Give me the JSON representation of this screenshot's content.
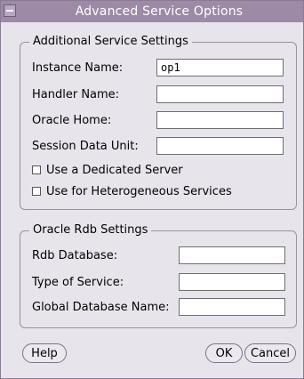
{
  "window": {
    "title": "Advanced Service Options"
  },
  "additional": {
    "legend": "Additional Service Settings",
    "fields": [
      {
        "label": "Instance Name:",
        "value": "op1"
      },
      {
        "label": "Handler Name:",
        "value": ""
      },
      {
        "label": "Oracle Home:",
        "value": ""
      },
      {
        "label": "Session Data Unit:",
        "value": ""
      }
    ],
    "checks": [
      {
        "label": "Use a Dedicated Server",
        "checked": false
      },
      {
        "label": "Use for Heterogeneous Services",
        "checked": false
      }
    ]
  },
  "rdb": {
    "legend": "Oracle Rdb Settings",
    "fields": [
      {
        "label": "Rdb Database:",
        "value": ""
      },
      {
        "label": "Type of Service:",
        "value": ""
      },
      {
        "label": "Global Database Name:",
        "value": ""
      }
    ]
  },
  "buttons": {
    "help": "Help",
    "ok": "OK",
    "cancel": "Cancel"
  }
}
